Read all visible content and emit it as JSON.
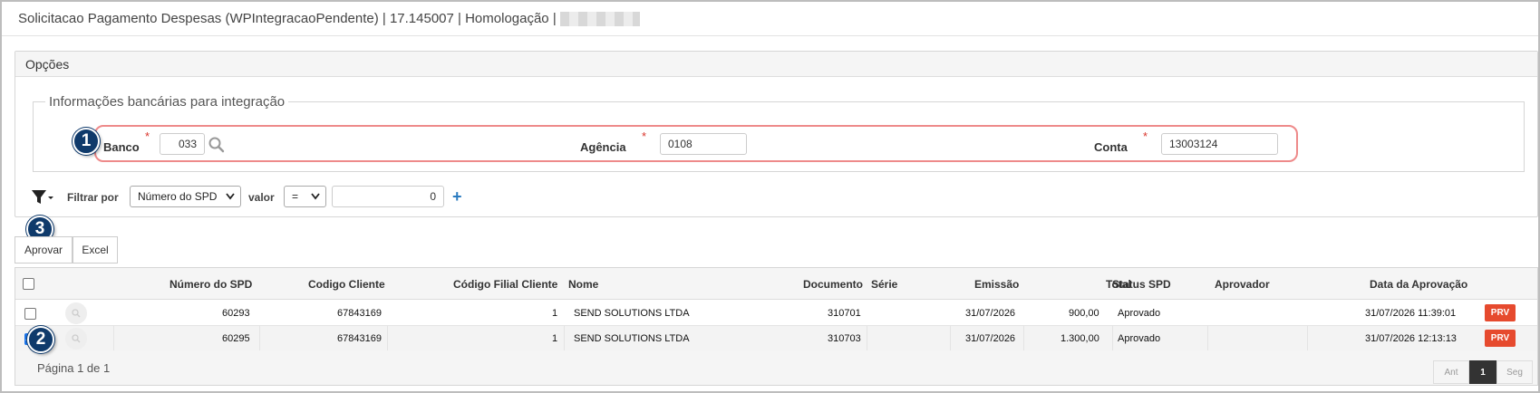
{
  "window": {
    "title": "Solicitacao Pagamento Despesas (WPIntegracaoPendente) | 17.145007 | Homologação |"
  },
  "options": {
    "header": "Opções",
    "bank_section_legend": "Informações bancárias para integração",
    "fields": {
      "banco": {
        "label": "Banco",
        "value": "033"
      },
      "agencia": {
        "label": "Agência",
        "value": "0108"
      },
      "conta": {
        "label": "Conta",
        "value": "13003124"
      },
      "required_mark": "*"
    },
    "filter": {
      "label": "Filtrar por",
      "field_selected": "Número do SPD",
      "value_label": "valor",
      "operator_selected": "=",
      "value": "0",
      "add_symbol": "+"
    }
  },
  "callouts": {
    "one": "1",
    "two": "2",
    "three": "3"
  },
  "toolbar": {
    "approve_label": "Aprovar",
    "excel_label": "Excel"
  },
  "grid": {
    "columns": [
      "Número do SPD",
      "Codigo Cliente",
      "Código Filial Cliente",
      "Nome",
      "Documento",
      "Série",
      "Emissão",
      "Total",
      "Status SPD",
      "Aprovador",
      "Data da Aprovação"
    ],
    "rows": [
      {
        "checked": false,
        "spd": "60293",
        "codigo_cliente": "67843169",
        "filial": "1",
        "nome": "SEND SOLUTIONS LTDA",
        "documento": "310701",
        "serie": "",
        "emissao": "31/07/2026",
        "total": "900,00",
        "status": "Aprovado",
        "aprovador": "",
        "data_aprovacao": "31/07/2026 11:39:01",
        "action": "PRV"
      },
      {
        "checked": true,
        "spd": "60295",
        "codigo_cliente": "67843169",
        "filial": "1",
        "nome": "SEND SOLUTIONS LTDA",
        "documento": "310703",
        "serie": "",
        "emissao": "31/07/2026",
        "total": "1.300,00",
        "status": "Aprovado",
        "aprovador": "",
        "data_aprovacao": "31/07/2026 12:13:13",
        "action": "PRV"
      }
    ],
    "page_info": "Página 1 de 1",
    "pager": {
      "prev": "Ant",
      "current": "1",
      "next": "Seg"
    }
  },
  "colors": {
    "accent_badge": "#0f3a6b",
    "highlight_border": "#ee8a8a",
    "prv_button": "#e64a2e",
    "required": "#d9342b"
  }
}
